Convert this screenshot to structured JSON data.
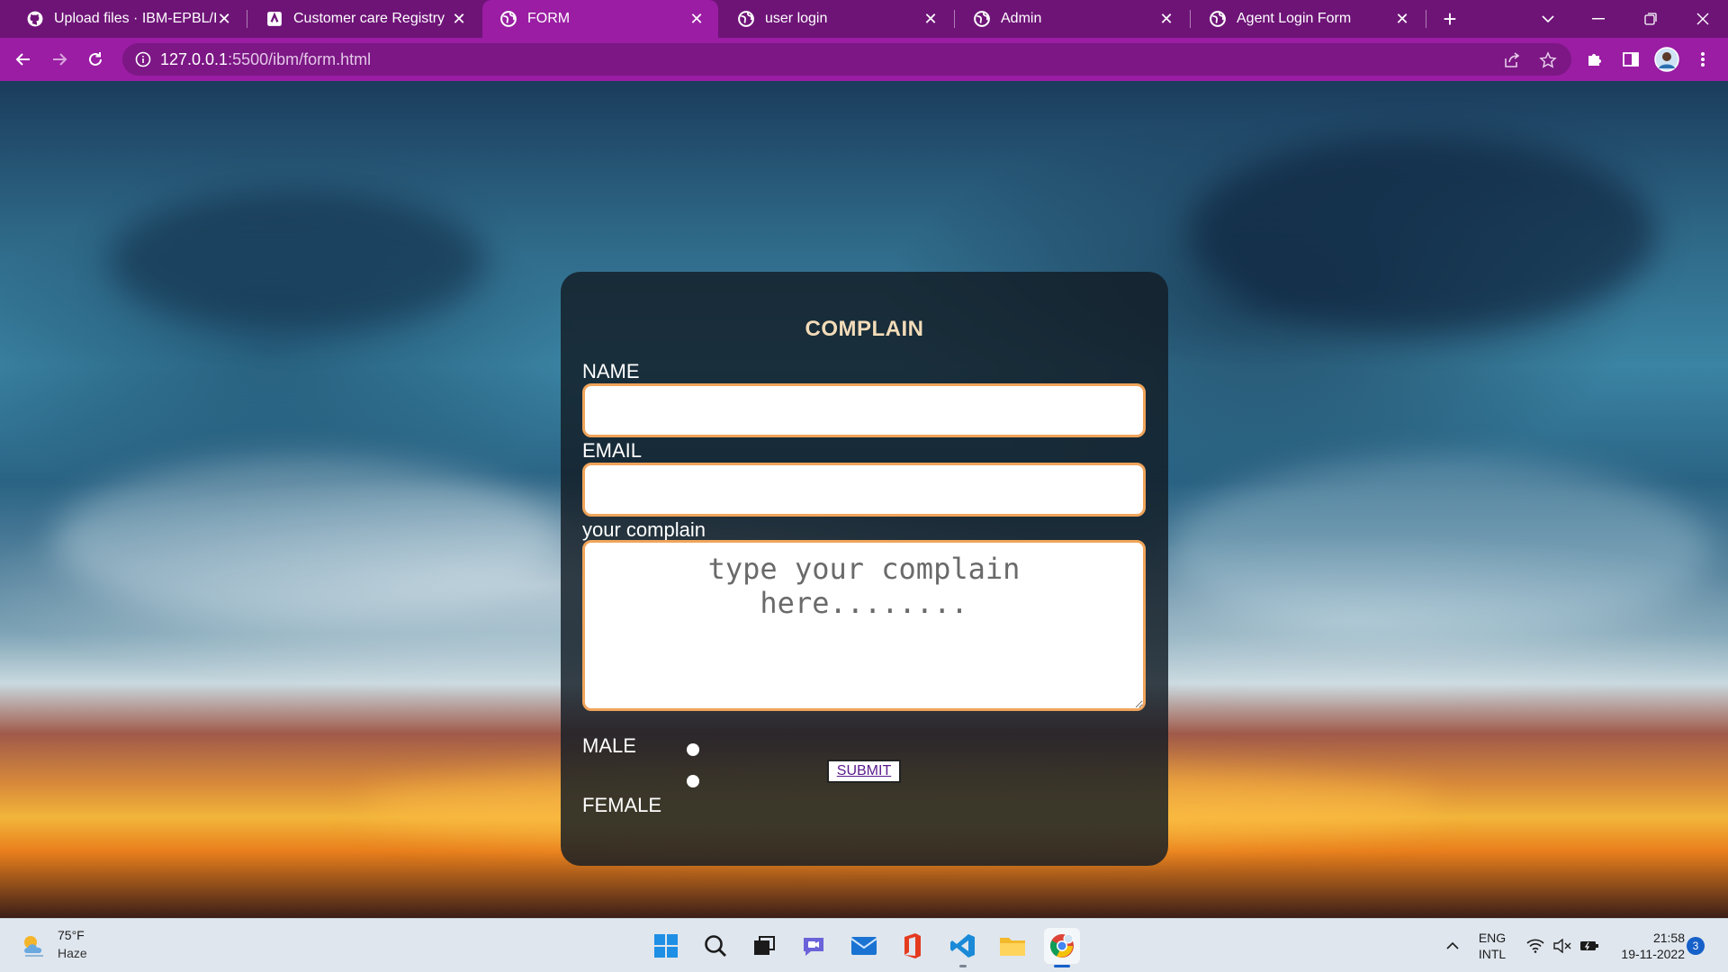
{
  "browser": {
    "tabs": [
      {
        "title": "Upload files · IBM-EPBL/IBM",
        "icon": "github-icon",
        "active": false
      },
      {
        "title": "Customer care Registry",
        "icon": "document-icon",
        "active": false
      },
      {
        "title": "FORM",
        "icon": "globe-icon",
        "active": true
      },
      {
        "title": "user login",
        "icon": "globe-icon",
        "active": false
      },
      {
        "title": "Admin",
        "icon": "globe-icon",
        "active": false
      },
      {
        "title": "Agent Login Form",
        "icon": "globe-icon",
        "active": false
      }
    ],
    "address": {
      "host": "127.0.0.1",
      "rest": ":5500/ibm/form.html"
    }
  },
  "form": {
    "title": "COMPLAIN",
    "name_label": "NAME",
    "name_value": "",
    "email_label": "EMAIL",
    "email_value": "",
    "complain_label": "your complain",
    "complain_placeholder": "type your complain here........",
    "male_label": "MALE",
    "female_label": "FEMALE",
    "submit_label": "SUBMIT"
  },
  "taskbar": {
    "weather_temp": "75°F",
    "weather_condition": "Haze",
    "language_line1": "ENG",
    "language_line2": "INTL",
    "time": "21:58",
    "date": "19-11-2022",
    "notification_count": "3"
  },
  "colors": {
    "tab_bar": "#6e1477",
    "toolbar": "#9a1da3",
    "input_border": "#f0a45a",
    "form_title": "#f3dcb9"
  }
}
